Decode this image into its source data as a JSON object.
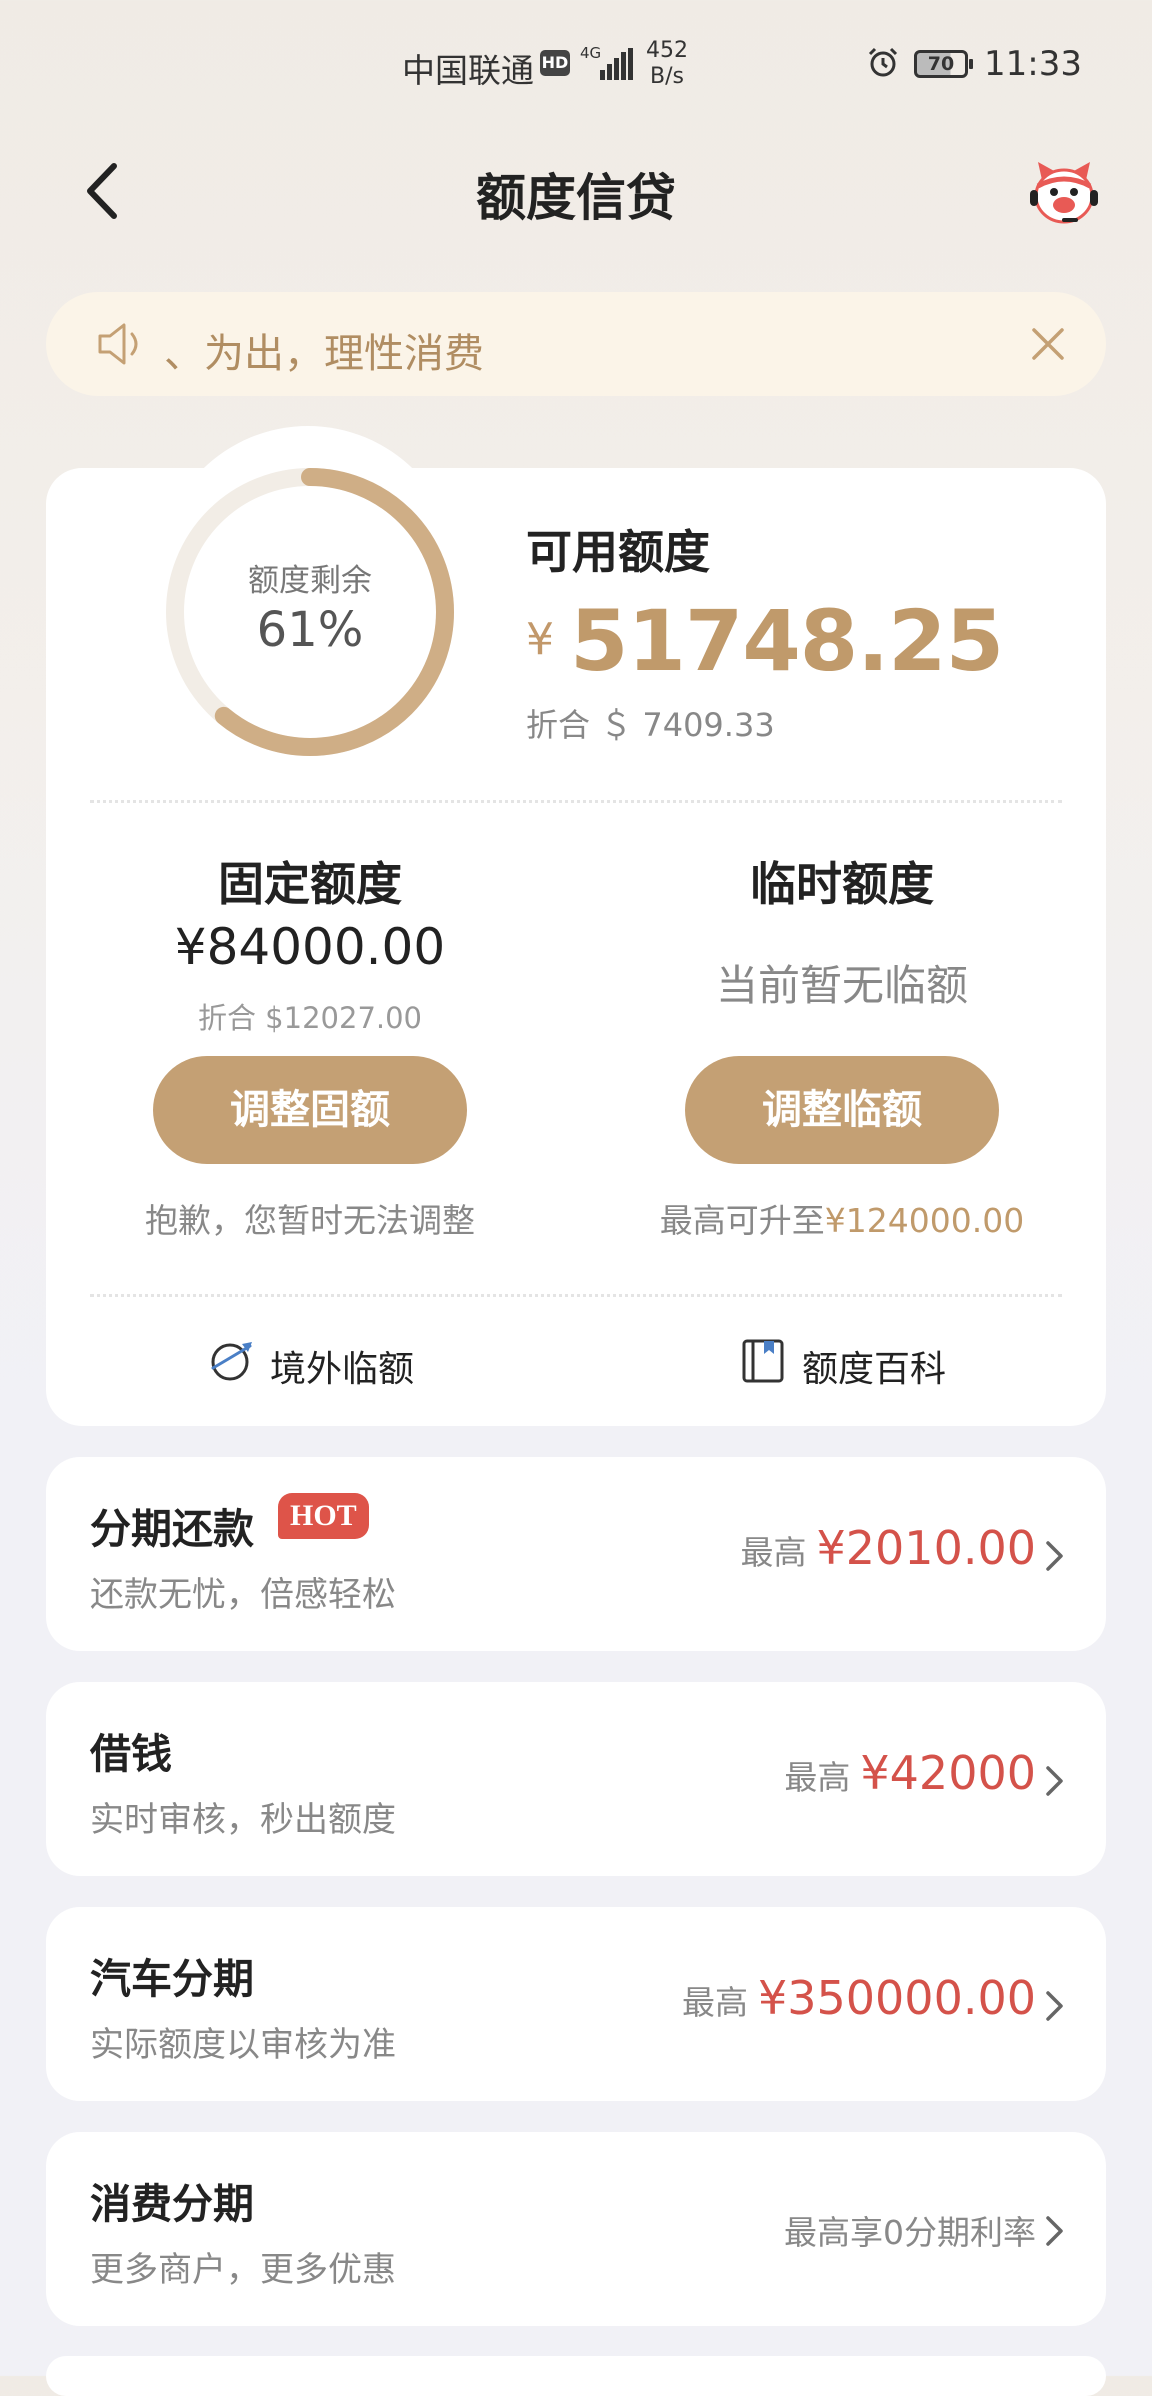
{
  "status_bar": {
    "carrier": "中国联通",
    "hd": "HD",
    "network": "4G",
    "speed_value": "452",
    "speed_unit": "B/s",
    "battery": "70",
    "time": "11:33"
  },
  "header": {
    "title": "额度信贷"
  },
  "notice": {
    "text": "、为出，理性消费"
  },
  "credit": {
    "ring_label": "额度剩余",
    "ring_percent_text": "61%",
    "remaining_fraction": 0.61,
    "available_label": "可用额度",
    "currency_symbol": "¥",
    "available_value": "51748.25",
    "available_converted": "折合 ＄ 7409.33",
    "fixed": {
      "title": "固定额度",
      "value": "¥84000.00",
      "converted": "折合 $12027.00",
      "button": "调整固额",
      "note": "抱歉，您暂时无法调整"
    },
    "temporary": {
      "title": "临时额度",
      "status": "当前暂无临额",
      "button": "调整临额",
      "note_prefix": "最高可升至",
      "note_amount": "¥124000.00"
    },
    "links": [
      {
        "label": "境外临额",
        "icon": "globe-plane-icon"
      },
      {
        "label": "额度百科",
        "icon": "book-icon"
      }
    ]
  },
  "services": [
    {
      "title": "分期还款",
      "badge": "HOT",
      "subtitle": "还款无忧，倍感轻松",
      "prefix": "最高",
      "amount": "¥2010.00"
    },
    {
      "title": "借钱",
      "subtitle": "实时审核，秒出额度",
      "prefix": "最高",
      "amount": "¥42000"
    },
    {
      "title": "汽车分期",
      "subtitle": "实际额度以审核为准",
      "prefix": "最高",
      "amount": "¥350000.00"
    },
    {
      "title": "消费分期",
      "subtitle": "更多商户，更多优惠",
      "right_text": "最高享0分期利率"
    }
  ],
  "colors": {
    "gold": "#c4a074",
    "amount_red": "#d4524a",
    "hot_badge": "#de5449",
    "notice_bg": "#fbf4e8"
  }
}
